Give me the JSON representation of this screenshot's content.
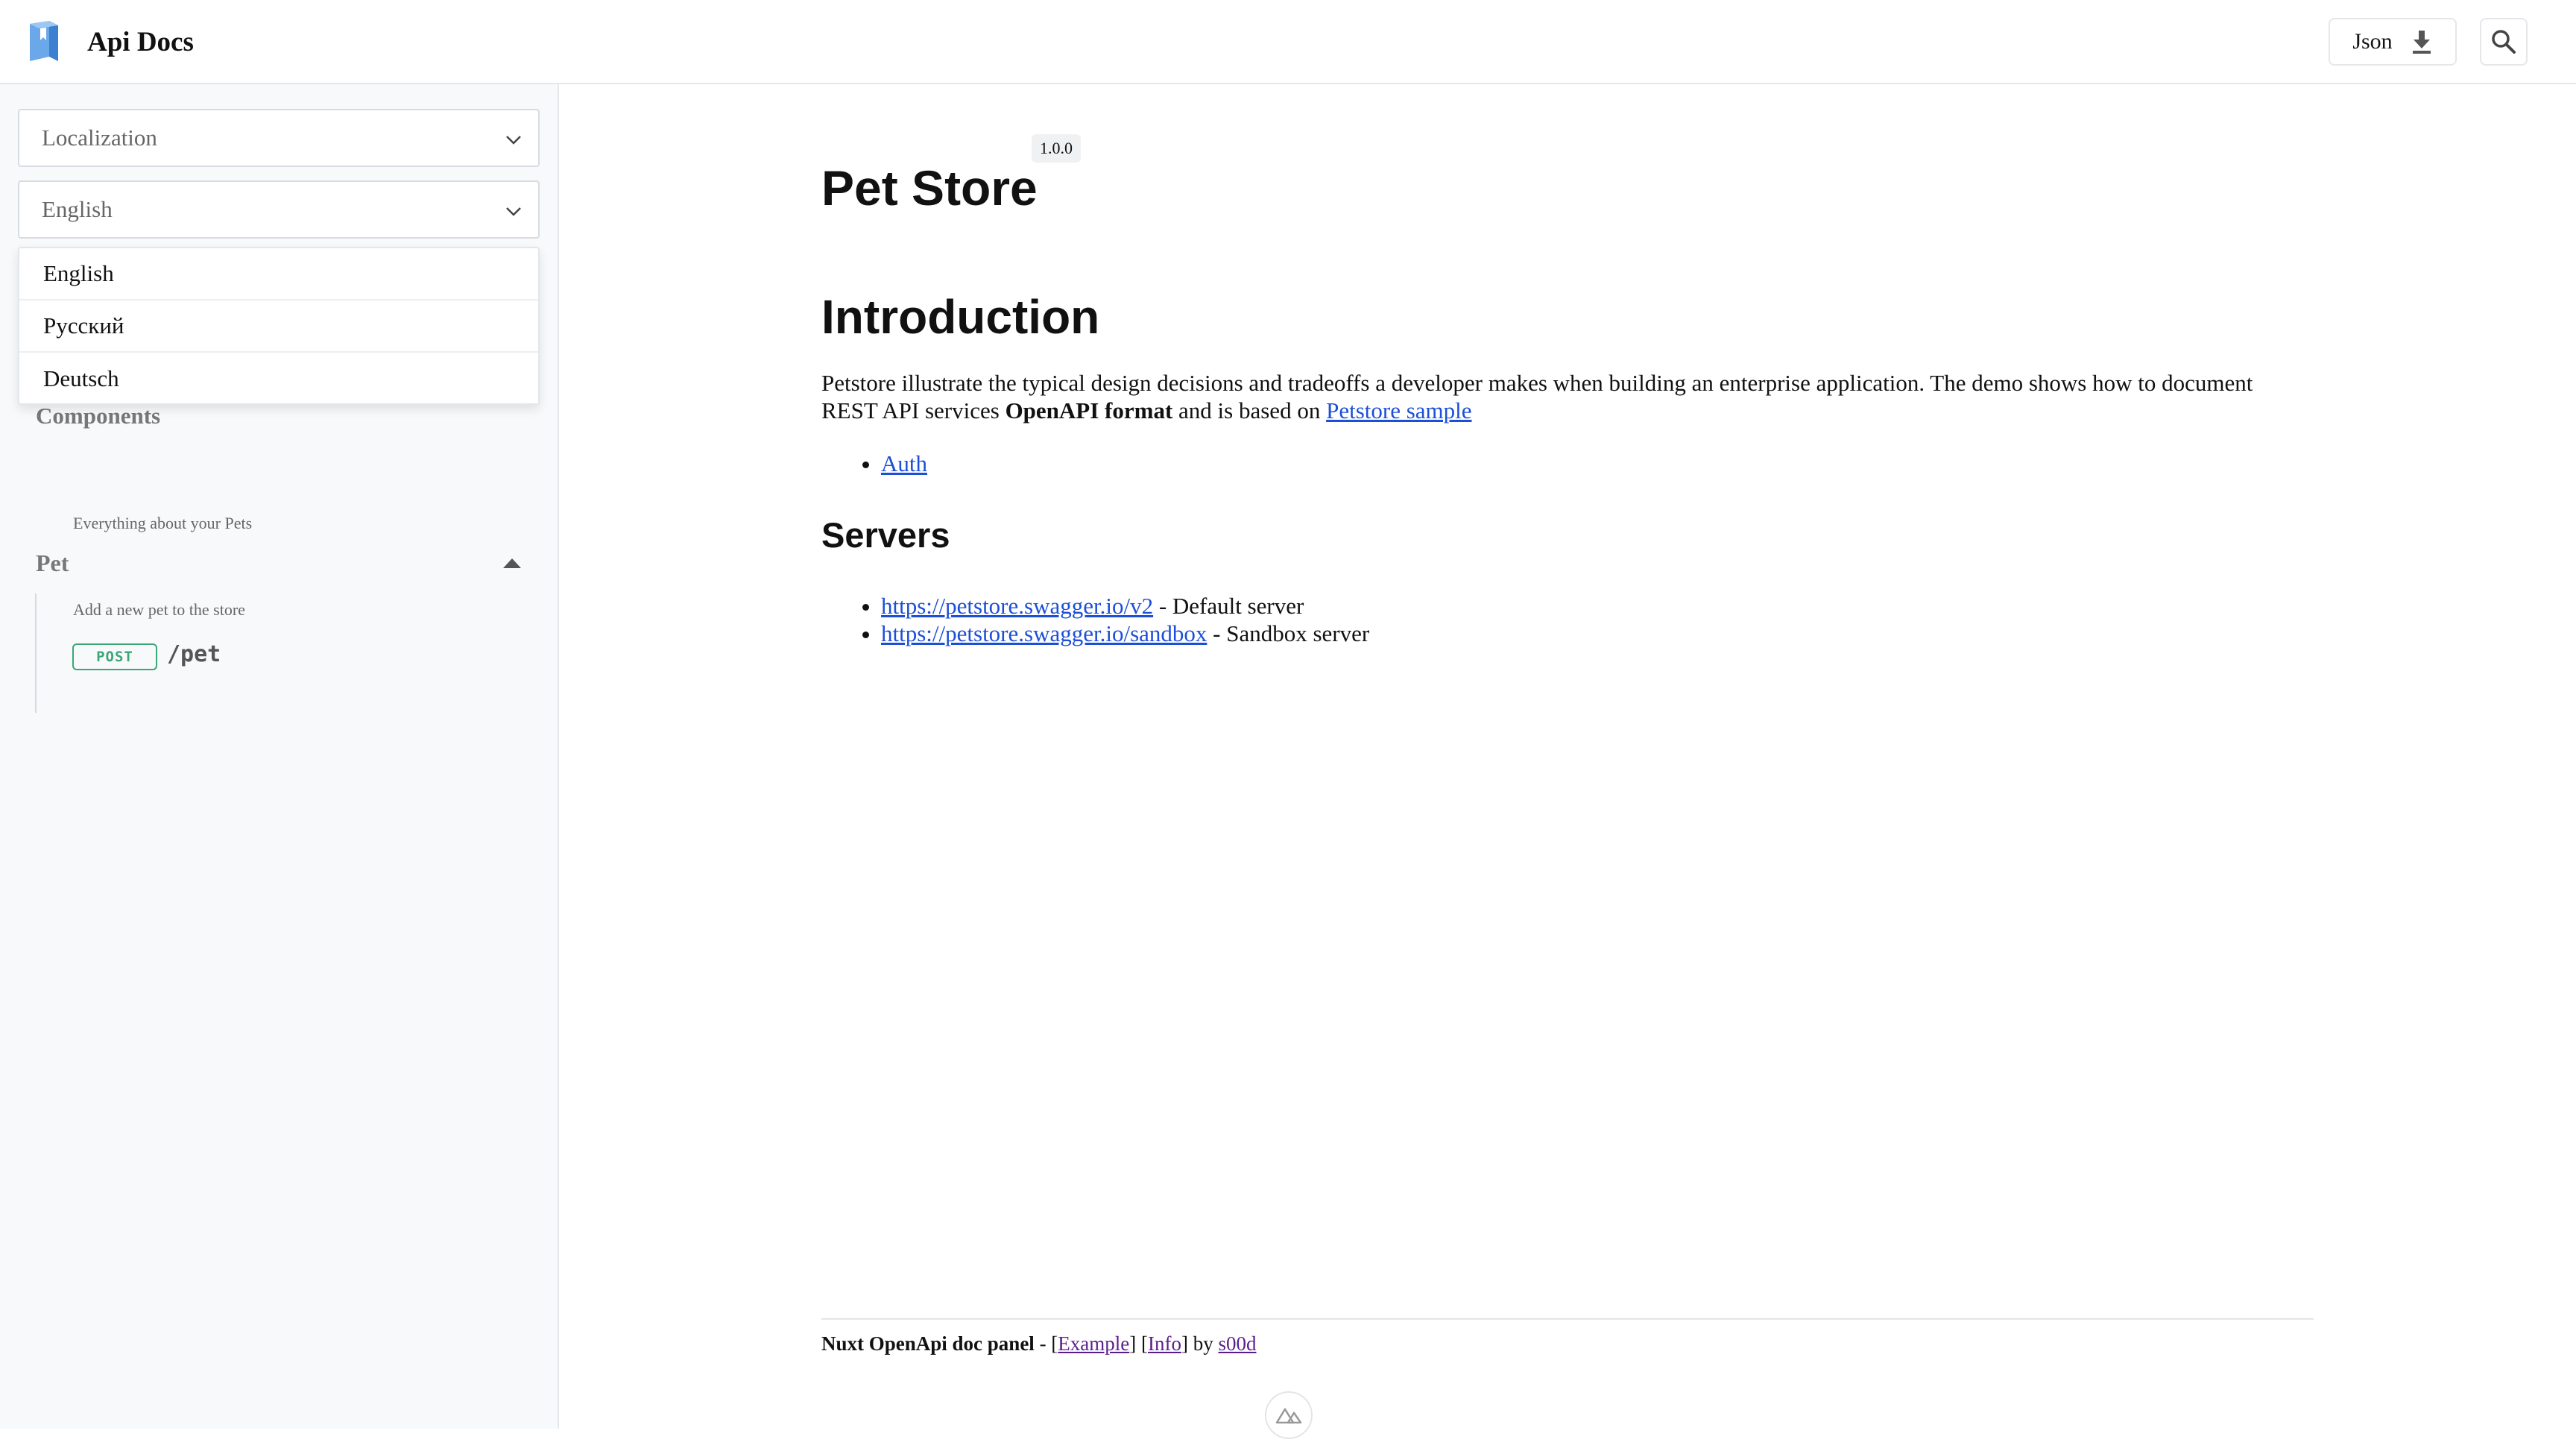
{
  "header": {
    "title": "Api Docs",
    "json_label": "Json"
  },
  "sidebar": {
    "localization_select": "Localization",
    "language_select": "English",
    "language_options": [
      "English",
      "Русский",
      "Deutsch"
    ],
    "components_label": "Components",
    "group": {
      "title": "Pet",
      "description": "Everything about your Pets",
      "endpoint": {
        "method": "POST",
        "path": "/pet",
        "summary": "Add a new pet to the store"
      }
    }
  },
  "main": {
    "title": "Pet Store",
    "version": "1.0.0",
    "intro_heading": "Introduction",
    "intro": {
      "text_1": "Petstore illustrate the typical design decisions and tradeoffs a developer makes when building an enterprise application. The demo shows how to document REST API services ",
      "bold": "OpenAPI format",
      "text_2": " and is based on ",
      "link": "Petstore sample"
    },
    "intro_links": [
      "Auth"
    ],
    "servers_heading": "Servers",
    "servers": [
      {
        "url": "https://petstore.swagger.io/v2",
        "description": " - Default server"
      },
      {
        "url": "https://petstore.swagger.io/sandbox",
        "description": " - Sandbox server"
      }
    ]
  },
  "footer": {
    "brand": "Nuxt OpenApi doc panel",
    "sep_1": " - [",
    "example": "Example",
    "sep_2": "] [",
    "info": "Info",
    "sep_3": "] by ",
    "author": "s00d"
  },
  "colors": {
    "accent_link": "#1c4fd8",
    "post_badge": "#3ba776",
    "logo_blue": "#4a90e2"
  }
}
